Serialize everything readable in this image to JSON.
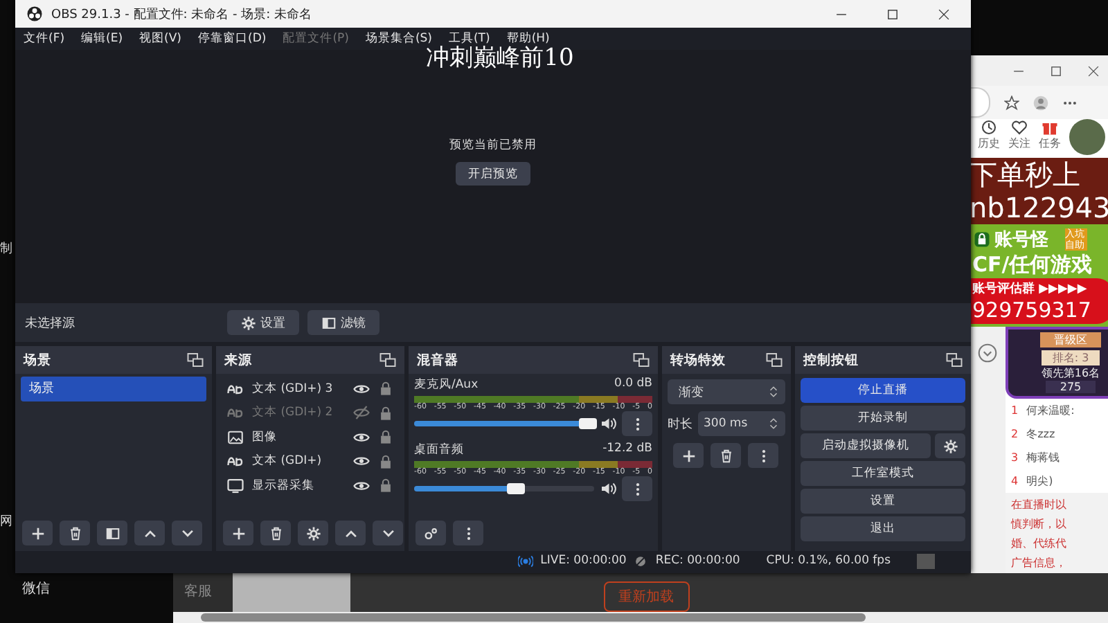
{
  "desktop": {
    "left_labels": [
      "制",
      "网",
      "微信"
    ]
  },
  "obs": {
    "title": "OBS 29.1.3 - 配置文件: 未命名 - 场景: 未命名",
    "menu": [
      {
        "label": "文件(F)",
        "disabled": false
      },
      {
        "label": "编辑(E)",
        "disabled": false
      },
      {
        "label": "视图(V)",
        "disabled": false
      },
      {
        "label": "停靠窗口(D)",
        "disabled": false
      },
      {
        "label": "配置文件(P)",
        "disabled": true
      },
      {
        "label": "场景集合(S)",
        "disabled": false
      },
      {
        "label": "工具(T)",
        "disabled": false
      },
      {
        "label": "帮助(H)",
        "disabled": false
      }
    ],
    "preview": {
      "overlay_text": "冲刺巅峰前10",
      "message": "预览当前已禁用",
      "button": "开启预览"
    },
    "source_toolbar": {
      "label": "未选择源",
      "buttons": [
        {
          "kind": "settings",
          "label": "设置"
        },
        {
          "kind": "filters",
          "label": "滤镜"
        }
      ]
    },
    "scenes": {
      "title": "场景",
      "items": [
        {
          "label": "场景",
          "selected": true
        }
      ]
    },
    "sources": {
      "title": "来源",
      "items": [
        {
          "kind": "text",
          "label": "文本 (GDI+) 3",
          "visible": true
        },
        {
          "kind": "text",
          "label": "文本 (GDI+) 2",
          "visible": false
        },
        {
          "kind": "image",
          "label": "图像",
          "visible": true
        },
        {
          "kind": "text",
          "label": "文本 (GDI+)",
          "visible": true
        },
        {
          "kind": "display",
          "label": "显示器采集",
          "visible": true
        }
      ]
    },
    "mixer": {
      "title": "混音器",
      "channels": [
        {
          "name": "麦克风/Aux",
          "reading": "0.0 dB",
          "level": 1,
          "ticks": [
            "-60",
            "-55",
            "-50",
            "-45",
            "-40",
            "-35",
            "-30",
            "-25",
            "-20",
            "-15",
            "-10",
            "-5",
            "0"
          ]
        },
        {
          "name": "桌面音频",
          "reading": "-12.2 dB",
          "level": 0.6,
          "ticks": [
            "-60",
            "-55",
            "-50",
            "-45",
            "-40",
            "-35",
            "-30",
            "-25",
            "-20",
            "-15",
            "-10",
            "-5",
            "0"
          ]
        }
      ]
    },
    "transitions": {
      "title": "转场特效",
      "value": "渐变",
      "duration_label": "时长",
      "duration": "300 ms"
    },
    "controls": {
      "title": "控制按钮",
      "buttons": [
        {
          "label": "停止直播",
          "active": true,
          "kind": "plain"
        },
        {
          "label": "开始录制",
          "active": false,
          "kind": "plain"
        },
        {
          "label": "启动虚拟摄像机",
          "active": false,
          "kind": "with-settings"
        },
        {
          "label": "工作室模式",
          "active": false,
          "kind": "plain"
        },
        {
          "label": "设置",
          "active": false,
          "kind": "plain"
        },
        {
          "label": "退出",
          "active": false,
          "kind": "plain"
        }
      ]
    },
    "status_bar": {
      "live": "LIVE: 00:00:00",
      "rec": "REC: 00:00:00",
      "cpu": "CPU: 0.1%, 60.00 fps"
    }
  },
  "browser": {
    "nav": [
      "历史",
      "关注",
      "任务"
    ],
    "overlay_lines": [
      "下单秒上",
      "nb122943"
    ],
    "ad": {
      "brand": "账号怪",
      "badge": "入坑自助",
      "headline": "CF/任何游戏",
      "group": "账号评估群 ▶▶▶▶▶",
      "number": "929759317"
    },
    "rank_card": {
      "zone": "晋级区",
      "rank": "排名: 3",
      "lead": "领先第16名",
      "score": "275"
    },
    "list": [
      {
        "rank": "1",
        "name": "何来温暖:"
      },
      {
        "rank": "2",
        "name": "冬zzz"
      },
      {
        "rank": "3",
        "name": "梅蒋钱"
      },
      {
        "rank": "4",
        "name": "明尖)"
      }
    ],
    "notice": [
      "在直播时以",
      "慎判断，以",
      "婚、代练代",
      "广告信息，"
    ]
  },
  "bottom_window": {
    "tab": "客服",
    "button": "重新加载"
  }
}
